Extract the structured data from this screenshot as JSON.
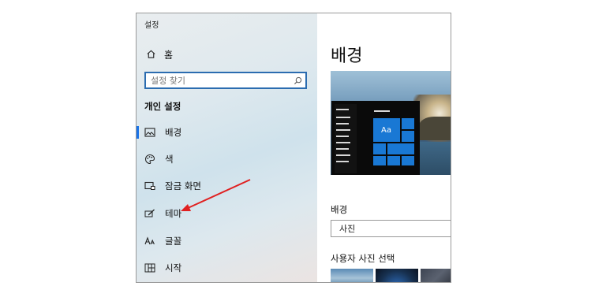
{
  "app": {
    "title": "설정"
  },
  "sidebar": {
    "home_label": "홈",
    "search_placeholder": "설정 찾기",
    "section_title": "개인 설정",
    "items": [
      {
        "label": "배경",
        "icon": "picture-icon",
        "active": true
      },
      {
        "label": "색",
        "icon": "palette-icon",
        "active": false
      },
      {
        "label": "잠금 화면",
        "icon": "lock-screen-icon",
        "active": false
      },
      {
        "label": "테마",
        "icon": "theme-brush-icon",
        "active": false
      },
      {
        "label": "글꼴",
        "icon": "font-icon",
        "active": false
      },
      {
        "label": "시작",
        "icon": "start-grid-icon",
        "active": false
      }
    ]
  },
  "main": {
    "title": "배경",
    "preview_tile_text": "Aa",
    "background_label": "배경",
    "background_value": "사진",
    "pick_photo_label": "사용자 사진 선택"
  },
  "colors": {
    "accent": "#1978d4",
    "annotation_arrow": "#e02020"
  }
}
